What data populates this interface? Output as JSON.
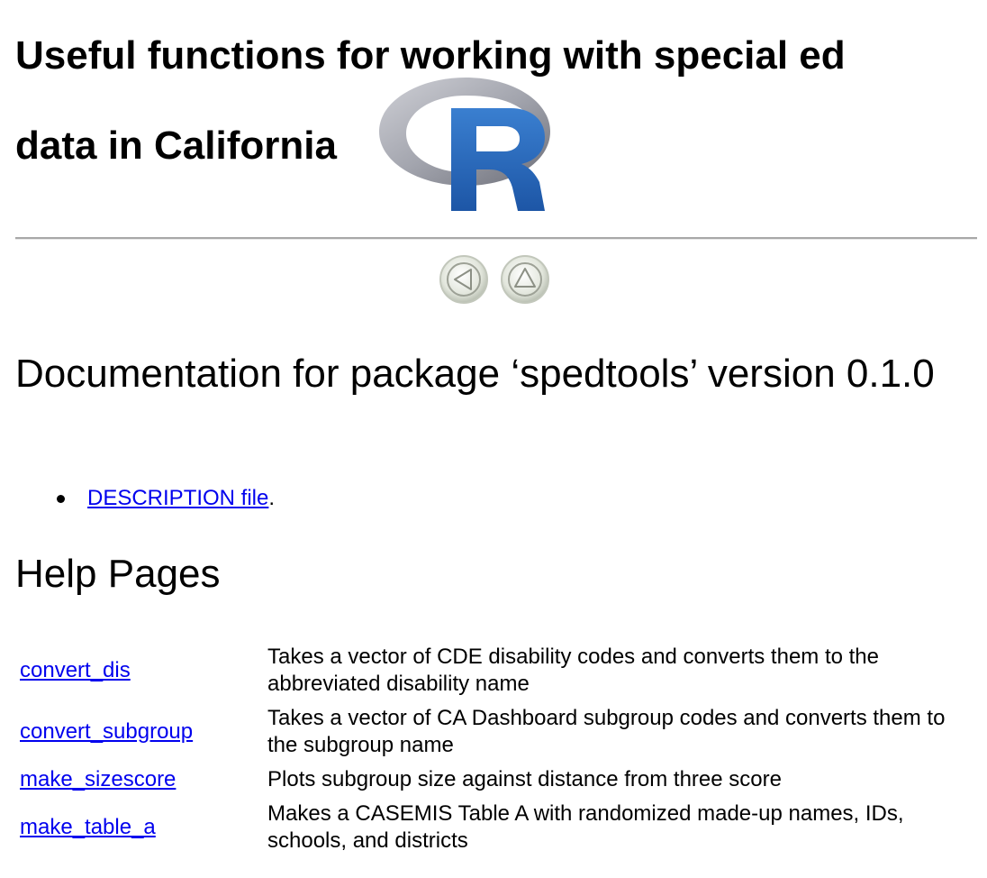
{
  "header": {
    "title_line1": "Useful functions for working with special ed",
    "title_line2": "data in California",
    "logo_icon": "r-logo-icon"
  },
  "nav": {
    "prev_icon": "left-arrow-icon",
    "up_icon": "up-arrow-icon"
  },
  "documentation": {
    "heading": "Documentation for package ‘spedtools’ version 0.1.0",
    "items": [
      {
        "link_text": "DESCRIPTION file",
        "suffix": "."
      }
    ]
  },
  "help_pages": {
    "heading": "Help Pages",
    "rows": [
      {
        "name": "convert_dis",
        "description": "Takes a vector of CDE disability codes and converts them to the abbreviated disability name"
      },
      {
        "name": "convert_subgroup",
        "description": "Takes a vector of CA Dashboard subgroup codes and converts them to the subgroup name"
      },
      {
        "name": "make_sizescore",
        "description": "Plots subgroup size against distance from three score"
      },
      {
        "name": "make_table_a",
        "description": "Makes a CASEMIS Table A with randomized made-up names, IDs, schools, and districts"
      }
    ]
  },
  "colors": {
    "link": "#0000ee",
    "logo_blue": "#2266b8",
    "logo_ring": "#9a9ca6",
    "divider": "#a8a8a8"
  }
}
